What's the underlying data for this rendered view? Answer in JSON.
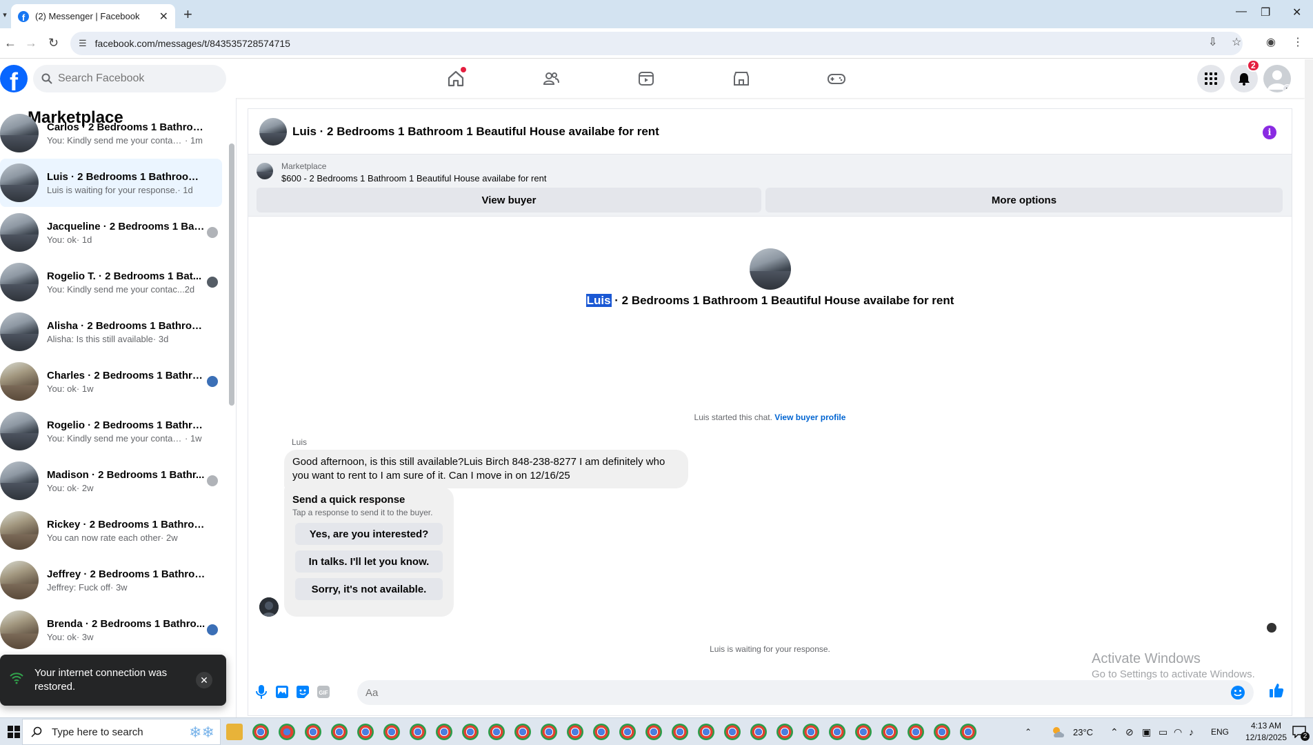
{
  "browser": {
    "tab_title": "(2) Messenger | Facebook",
    "url": "facebook.com/messages/t/843535728574715"
  },
  "fb": {
    "search_placeholder": "Search Facebook",
    "notification_count": "2"
  },
  "sidebar": {
    "title": "Marketplace",
    "conversations": [
      {
        "name": "Carlos · 2 Bedrooms 1 Bathroom...",
        "snippet": "You: Kindly send me your contact ...",
        "time": " · 1m",
        "thumb": "house-dark",
        "active": false,
        "seen": false
      },
      {
        "name": "Luis · 2 Bedrooms 1 Bathroom 1 ...",
        "snippet": "Luis is waiting for your response.",
        "time": " · 1d",
        "thumb": "house-dark",
        "active": true,
        "seen": false
      },
      {
        "name": "Jacqueline · 2 Bedrooms 1 Bat...",
        "snippet": "You: ok",
        "time": " · 1d",
        "thumb": "house-dark",
        "active": false,
        "seen": true
      },
      {
        "name": "Rogelio T. · 2 Bedrooms 1 Bat...",
        "snippet": "You: Kindly send me your contac...",
        "time": " 2d",
        "thumb": "house-dark",
        "active": false,
        "seen": true
      },
      {
        "name": "Alisha · 2 Bedrooms 1 Bathroom ...",
        "snippet": "Alisha: Is this still available",
        "time": " · 3d",
        "thumb": "house-dark",
        "active": false,
        "seen": false
      },
      {
        "name": "Charles · 2 Bedrooms 1 Bathro...",
        "snippet": "You: ok",
        "time": " · 1w",
        "thumb": "house-brown",
        "active": false,
        "seen": true
      },
      {
        "name": "Rogelio · 2 Bedrooms 1 Bathroo...",
        "snippet": "You: Kindly send me your contact n...",
        "time": " · 1w",
        "thumb": "house-dark",
        "active": false,
        "seen": false
      },
      {
        "name": "Madison · 2 Bedrooms 1 Bathr...",
        "snippet": "You: ok",
        "time": " · 2w",
        "thumb": "house-dark",
        "active": false,
        "seen": true
      },
      {
        "name": "Rickey · 2 Bedrooms 1 Bathroom...",
        "snippet": "You can now rate each other",
        "time": " · 2w",
        "thumb": "house-brown",
        "active": false,
        "seen": false
      },
      {
        "name": "Jeffrey · 2 Bedrooms 1 Bathroom...",
        "snippet": "Jeffrey: Fuck off",
        "time": " · 3w",
        "thumb": "house-brown",
        "active": false,
        "seen": false
      },
      {
        "name": "Brenda · 2 Bedrooms 1 Bathro...",
        "snippet": "You: ok",
        "time": " · 3w",
        "thumb": "house-brown",
        "active": false,
        "seen": true
      }
    ]
  },
  "toast": {
    "message": "Your internet connection was restored."
  },
  "chat": {
    "header_title": "Luis · 2 Bedrooms 1 Bathroom 1 Beautiful House availabe for rent",
    "marketplace_label": "Marketplace",
    "listing": "$600 - 2 Bedrooms 1 Bathroom 1 Beautiful House availabe for rent",
    "view_buyer": "View buyer",
    "more_options": "More options",
    "center_title_highlight": "Luis",
    "center_title_rest": " · 2 Bedrooms 1 Bathroom 1 Beautiful House availabe for rent",
    "started_text": "Luis started this chat. ",
    "view_buyer_profile": "View buyer profile",
    "sender_name": "Luis",
    "message": "Good afternoon, is this still available?Luis Birch 848-238-8277 I am definitely who you want to rent to I am sure of it. Can I move in on 12/16/25",
    "quick_response": {
      "heading": "Send a quick response",
      "subheading": "Tap a response to send it to the buyer.",
      "options": [
        "Yes, are you interested?",
        "In talks. I'll let you know.",
        "Sorry, it's not available."
      ]
    },
    "waiting_text": "Luis is waiting for your response.",
    "composer_placeholder": "Aa"
  },
  "watermark": {
    "line1": "Activate Windows",
    "line2": "Go to Settings to activate Windows."
  },
  "taskbar": {
    "search_placeholder": "Type here to search",
    "temperature": "23°C",
    "language": "ENG",
    "time": "4:13 AM",
    "date": "12/18/2025",
    "notifications": "2"
  },
  "colors": {
    "fb_blue": "#0866ff",
    "accent_blue": "#0084ff",
    "badge_red": "#e41e3f",
    "info_purple": "#8a2be2"
  }
}
